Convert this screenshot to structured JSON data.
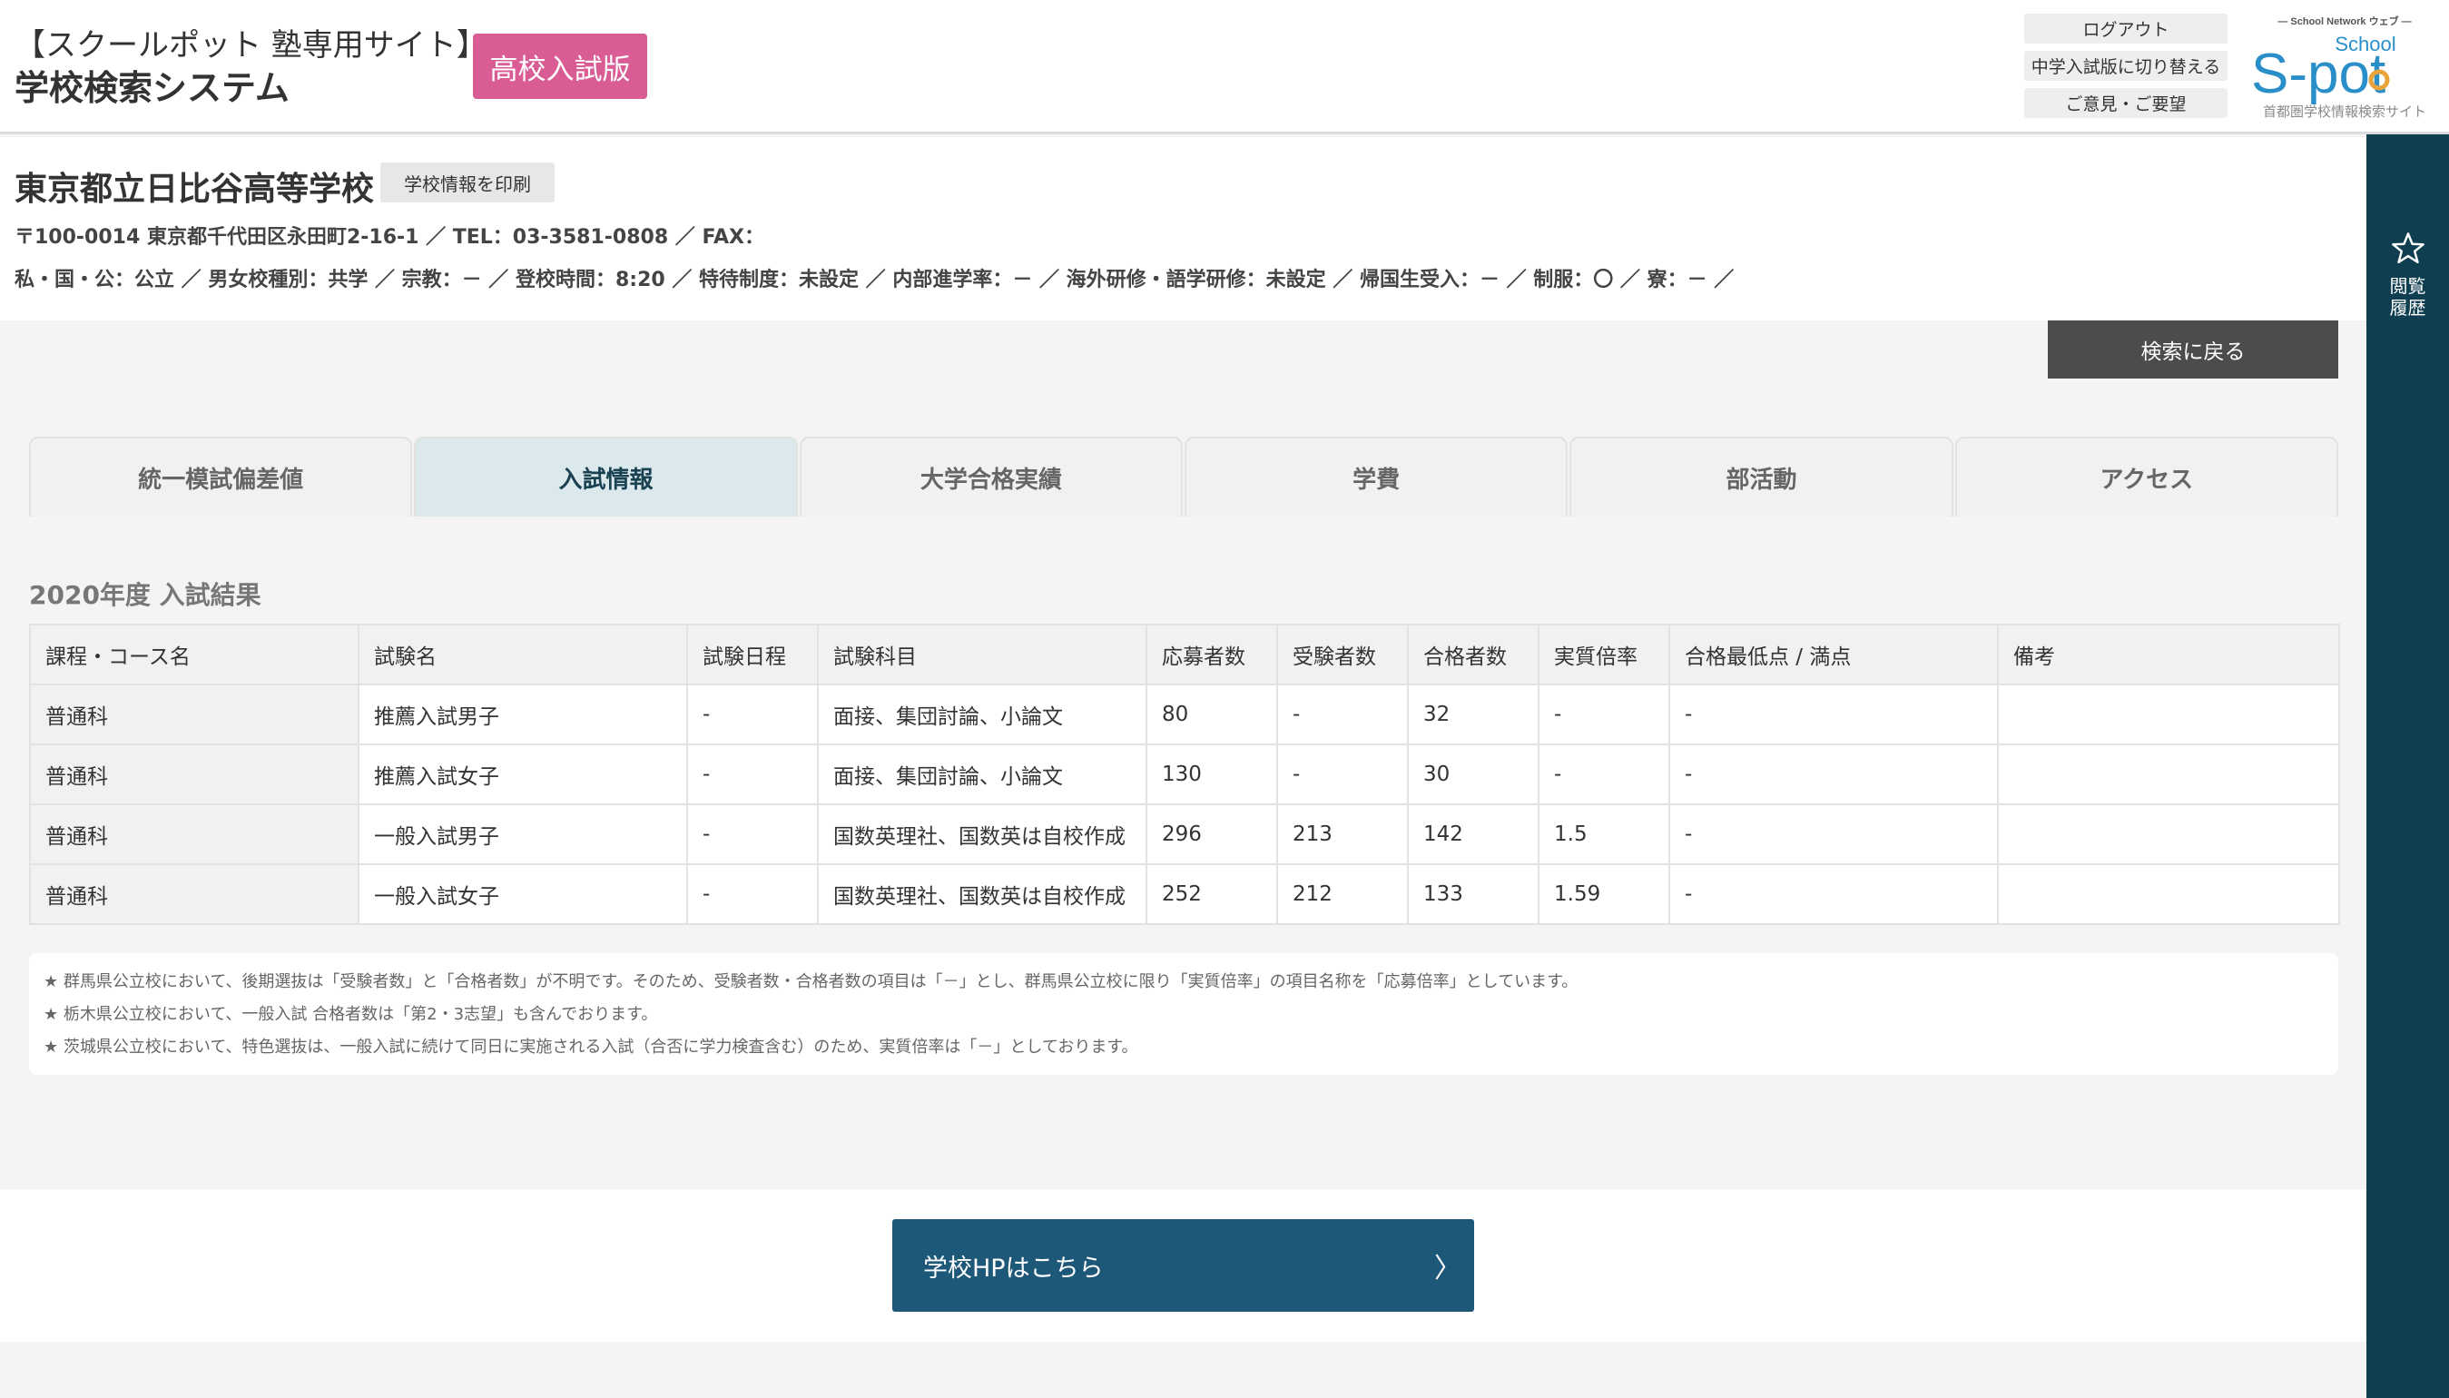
{
  "header": {
    "site_sub": "【スクールポット 塾専用サイト】",
    "site_title": "学校検索システム",
    "edition_badge": "高校入試版",
    "logout_label": "ログアウト",
    "switch_label": "中学入試版に切り替える",
    "feedback_label": "ご意見・ご要望",
    "logo": {
      "top_text": "— School Network ウェブ —",
      "school_text": "School",
      "spot_text": "S-pot",
      "caption": "首都圏学校情報検索サイト"
    }
  },
  "side_rail": {
    "history_icon": "star-icon",
    "history_label": "閲覧履歴"
  },
  "school": {
    "name": "東京都立日比谷高等学校",
    "print_label": "学校情報を印刷",
    "address_line": "〒100-0014 東京都千代田区永田町2-16-1 ／ TEL：03-3581-0808 ／ FAX：",
    "details_line": "私・国・公：公立 ／ 男女校種別：共学 ／ 宗教：－ ／ 登校時間：8:20 ／ 特待制度：未設定 ／ 内部進学率：－ ／ 海外研修・語学研修：未設定 ／ 帰国生受入：－ ／ 制服：〇 ／ 寮：－ ／"
  },
  "back_label": "検索に戻る",
  "tabs": [
    {
      "label": "統一模試偏差値",
      "active": false
    },
    {
      "label": "入試情報",
      "active": true
    },
    {
      "label": "大学合格実績",
      "active": false
    },
    {
      "label": "学費",
      "active": false
    },
    {
      "label": "部活動",
      "active": false
    },
    {
      "label": "アクセス",
      "active": false
    }
  ],
  "section_title": "2020年度 入試結果",
  "table": {
    "headers": [
      "課程・コース名",
      "試験名",
      "試験日程",
      "試験科目",
      "応募者数",
      "受験者数",
      "合格者数",
      "実質倍率",
      "合格最低点 / 満点",
      "備考"
    ],
    "rows": [
      [
        "普通科",
        "推薦入試男子",
        "-",
        "面接、集団討論、小論文",
        "80",
        "-",
        "32",
        "-",
        "-",
        ""
      ],
      [
        "普通科",
        "推薦入試女子",
        "-",
        "面接、集団討論、小論文",
        "130",
        "-",
        "30",
        "-",
        "-",
        ""
      ],
      [
        "普通科",
        "一般入試男子",
        "-",
        "国数英理社、国数英は自校作成",
        "296",
        "213",
        "142",
        "1.5",
        "-",
        ""
      ],
      [
        "普通科",
        "一般入試女子",
        "-",
        "国数英理社、国数英は自校作成",
        "252",
        "212",
        "133",
        "1.59",
        "-",
        ""
      ]
    ]
  },
  "notes": [
    "★ 群馬県公立校において、後期選抜は「受験者数」と「合格者数」が不明です。そのため、受験者数・合格者数の項目は「－」とし、群馬県公立校に限り「実質倍率」の項目名称を「応募倍率」としています。",
    "★ 栃木県公立校において、一般入試 合格者数は「第2・3志望」も含んでおります。",
    "★ 茨城県公立校において、特色選抜は、一般入試に続けて同日に実施される入試（合否に学力検査含む）のため、実質倍率は「－」としております。"
  ],
  "hp_button": {
    "label": "学校HPはこちら",
    "arrow": "〉"
  }
}
